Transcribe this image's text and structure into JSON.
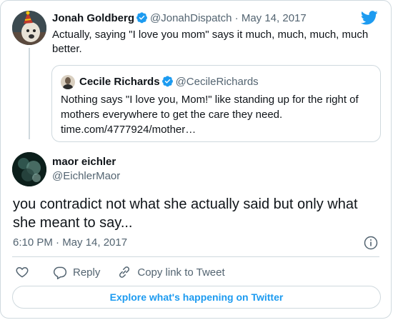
{
  "parent_tweet": {
    "name": "Jonah Goldberg",
    "handle": "@JonahDispatch",
    "separator": "·",
    "date": "May 14, 2017",
    "text": "Actually, saying \"I love you mom\" says it much, much, much, much better.",
    "avatar_icon": "dog-with-party-hat-avatar"
  },
  "quoted_tweet": {
    "name": "Cecile Richards",
    "handle": "@CecileRichards",
    "text": "Nothing says \"I love you, Mom!\" like standing up for the right of mothers everywhere to get the care they need.",
    "link": "time.com/4777924/mother…"
  },
  "main_tweet": {
    "name": "maor eichler",
    "handle": "@EichlerMaor",
    "text": "you contradict not what she actually said but only what she meant to say...",
    "timestamp": "6:10 PM · May 14, 2017"
  },
  "actions": {
    "reply_label": "Reply",
    "copy_link_label": "Copy link to Tweet"
  },
  "explore_label": "Explore what's happening on Twitter",
  "colors": {
    "twitter_blue": "#1d9bf0",
    "text_primary": "#0f1419",
    "text_secondary": "#536471",
    "border": "#cfd9de"
  }
}
